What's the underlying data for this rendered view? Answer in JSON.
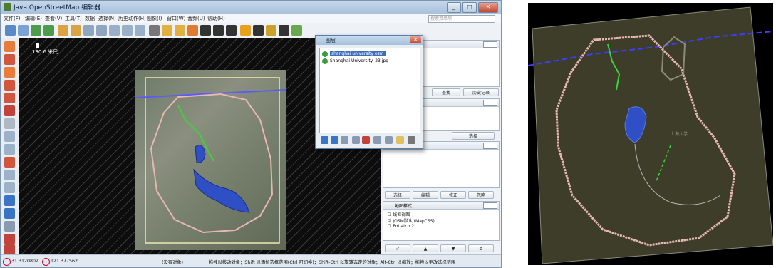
{
  "window": {
    "title": "Java OpenStreetMap 编辑器",
    "controls": [
      "_",
      "□",
      "✕"
    ]
  },
  "menu": {
    "items": [
      "文件(F)",
      "编辑(E)",
      "查看(V)",
      "工具(T)",
      "数据",
      "选择(N)",
      "历史动作(H)",
      "图像(I)",
      "窗口(W)",
      "音频(U)",
      "帮助(H)"
    ],
    "search_placeholder": "搜索菜单项"
  },
  "map": {
    "scale_label": "130.6 米尺"
  },
  "dialog": {
    "title": "图层",
    "items": [
      {
        "label": "shanghai university osm",
        "selected": true
      },
      {
        "label": "Shanghai University_23.jpg",
        "selected": false
      }
    ]
  },
  "right_panel": {
    "search_button": "查找",
    "history_button": "历史记录",
    "select_button": "选择",
    "tab_select": "选择",
    "tab_edit": "编辑",
    "tab_fix": "修正",
    "tab_ignore": "忽略",
    "map_styles_title": "地图样式",
    "styles": [
      {
        "label": "线框视图",
        "checked": false
      },
      {
        "label": "JOSM默认 (MapCSS)",
        "checked": true
      },
      {
        "label": "Potlatch 2",
        "checked": false
      }
    ]
  },
  "status": {
    "lat": "31.3120802",
    "lon": "121.377562",
    "dropdown": "(没有对象)",
    "hint": "拖拽以移动对象；Shift 以添加选择范围(Ctrl 可切换)；Shift-Ctrl 以旋转选定的对象；Alt-Ctrl 以缩放；拖拽以更改选择范围"
  },
  "zoom_view": {
    "label": "上海大学"
  },
  "colors": {
    "titlebar": "#a9c1dc",
    "map_bg": "#0d0d0d",
    "boundary": "#e8b8b2",
    "path_green": "#3fd13f",
    "water_blue": "#2f4fc4",
    "rail": "#3d3dff"
  }
}
